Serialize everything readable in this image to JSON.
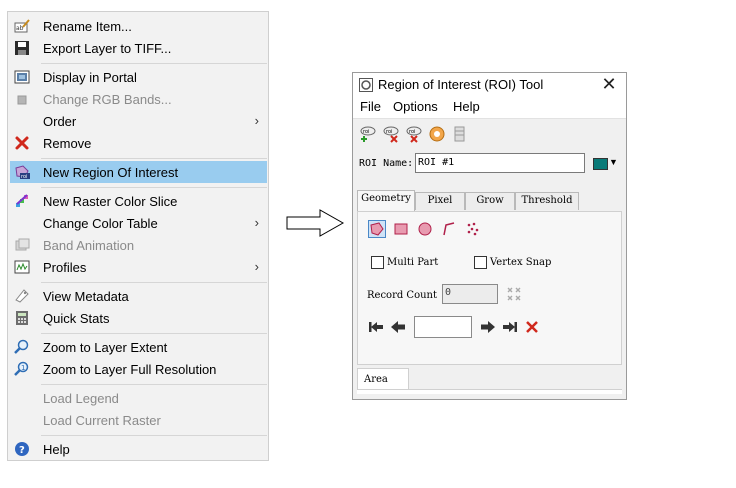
{
  "context_menu": {
    "items": [
      {
        "label": "Rename Item...",
        "icon": "rename-icon"
      },
      {
        "label": "Export Layer to TIFF...",
        "icon": "save-icon"
      },
      {
        "label": "Display in Portal",
        "icon": "portal-icon"
      },
      {
        "label": "Change RGB Bands...",
        "icon": "rgb-bands-icon",
        "disabled": true
      },
      {
        "label": "Order",
        "submenu": true
      },
      {
        "label": "Remove",
        "icon": "remove-icon"
      },
      {
        "label": "New Region Of Interest",
        "icon": "roi-icon",
        "selected": true
      },
      {
        "label": "New Raster Color Slice",
        "icon": "color-slice-icon"
      },
      {
        "label": "Change Color Table",
        "submenu": true
      },
      {
        "label": "Band Animation",
        "icon": "band-animation-icon",
        "disabled": true
      },
      {
        "label": "Profiles",
        "icon": "profiles-icon",
        "submenu": true
      },
      {
        "label": "View Metadata",
        "icon": "metadata-icon"
      },
      {
        "label": "Quick Stats",
        "icon": "calculator-icon"
      },
      {
        "label": "Zoom to Layer Extent",
        "icon": "zoom-extent-icon"
      },
      {
        "label": "Zoom to Layer Full Resolution",
        "icon": "zoom-full-res-icon"
      },
      {
        "label": "Load Legend",
        "disabled": true
      },
      {
        "label": "Load Current Raster",
        "disabled": true
      },
      {
        "label": "Help",
        "icon": "help-icon"
      }
    ],
    "submenu_arrow": "›"
  },
  "roi_window": {
    "title": "Region of Interest (ROI) Tool",
    "close": "✕",
    "menu": [
      "File",
      "Options",
      "Help"
    ],
    "roi_name_label": "ROI Name:",
    "roi_name_value": "ROI #1",
    "roi_color": "#0a7a78",
    "tabs": [
      "Geometry",
      "Pixel",
      "Grow",
      "Threshold"
    ],
    "active_tab": "Geometry",
    "multi_part": "Multi Part",
    "vertex_snap": "Vertex Snap",
    "record_count_label": "Record Count",
    "record_count_value": "0",
    "bottom_tab": "Area"
  },
  "colors": {
    "menu_bg": "#f2f2f2",
    "selected_bg": "#99ccef",
    "disabled_text": "#8a8a8a"
  }
}
